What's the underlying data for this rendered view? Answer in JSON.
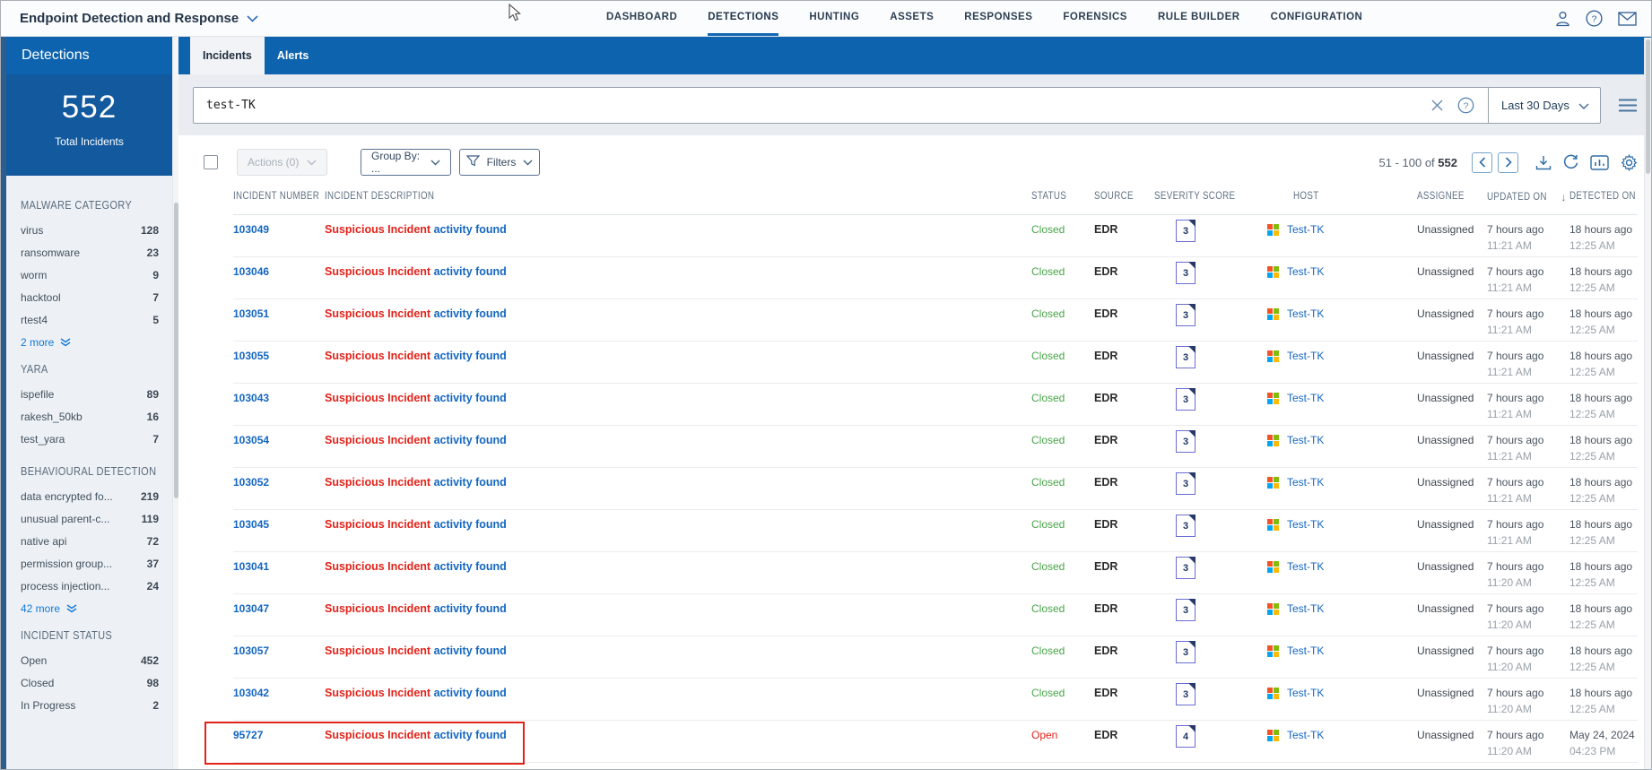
{
  "app": {
    "title": "Endpoint Detection and Response"
  },
  "nav": {
    "items": [
      {
        "label": "DASHBOARD",
        "active": false
      },
      {
        "label": "DETECTIONS",
        "active": true
      },
      {
        "label": "HUNTING",
        "active": false
      },
      {
        "label": "ASSETS",
        "active": false
      },
      {
        "label": "RESPONSES",
        "active": false
      },
      {
        "label": "FORENSICS",
        "active": false
      },
      {
        "label": "RULE BUILDER",
        "active": false
      },
      {
        "label": "CONFIGURATION",
        "active": false
      }
    ]
  },
  "top_icons": [
    "user-icon",
    "help-icon",
    "mail-icon"
  ],
  "sidebar": {
    "title": "Detections",
    "total": {
      "value": "552",
      "label": "Total Incidents"
    },
    "facets": [
      {
        "title": "MALWARE CATEGORY",
        "items": [
          {
            "label": "virus",
            "count": "128"
          },
          {
            "label": "ransomware",
            "count": "23"
          },
          {
            "label": "worm",
            "count": "9"
          },
          {
            "label": "hacktool",
            "count": "7"
          },
          {
            "label": "rtest4",
            "count": "5"
          }
        ],
        "more": "2 more"
      },
      {
        "title": "YARA",
        "items": [
          {
            "label": "ispefile",
            "count": "89"
          },
          {
            "label": "rakesh_50kb",
            "count": "16"
          },
          {
            "label": "test_yara",
            "count": "7"
          }
        ],
        "more": null
      },
      {
        "title": "BEHAVIOURAL DETECTION",
        "items": [
          {
            "label": "data encrypted fo...",
            "count": "219"
          },
          {
            "label": "unusual parent-c...",
            "count": "119"
          },
          {
            "label": "native api",
            "count": "72"
          },
          {
            "label": "permission group...",
            "count": "37"
          },
          {
            "label": "process injection...",
            "count": "24"
          }
        ],
        "more": "42 more"
      },
      {
        "title": "INCIDENT STATUS",
        "items": [
          {
            "label": "Open",
            "count": "452"
          },
          {
            "label": "Closed",
            "count": "98"
          },
          {
            "label": "In Progress",
            "count": "2"
          }
        ],
        "more": null
      }
    ]
  },
  "tabs": [
    {
      "label": "Incidents",
      "active": true
    },
    {
      "label": "Alerts",
      "active": false
    }
  ],
  "search": {
    "value": "test-TK",
    "date_range": "Last 30 Days"
  },
  "toolbar": {
    "actions_label": "Actions (0)",
    "group_by_label": "Group By: ...",
    "filters_label": "Filters",
    "pagination": {
      "range": "51 - 100 of",
      "total": "552"
    }
  },
  "table": {
    "columns": [
      "INCIDENT NUMBER",
      "INCIDENT DESCRIPTION",
      "STATUS",
      "SOURCE",
      "SEVERITY SCORE",
      "HOST",
      "ASSIGNEE",
      "UPDATED ON",
      "DETECTED ON"
    ],
    "sorted_column": "UPDATED ON",
    "rows": [
      {
        "number": "103049",
        "desc_red": "Suspicious Incident",
        "desc_blue": "activity found",
        "status": "Closed",
        "source": "EDR",
        "severity": "3",
        "host": "Test-TK",
        "assignee": "Unassigned",
        "updated": [
          "7 hours ago",
          "11:21 AM"
        ],
        "detected": [
          "18 hours ago",
          "12:25 AM"
        ],
        "highlighted": false
      },
      {
        "number": "103046",
        "desc_red": "Suspicious Incident",
        "desc_blue": "activity found",
        "status": "Closed",
        "source": "EDR",
        "severity": "3",
        "host": "Test-TK",
        "assignee": "Unassigned",
        "updated": [
          "7 hours ago",
          "11:21 AM"
        ],
        "detected": [
          "18 hours ago",
          "12:25 AM"
        ],
        "highlighted": false
      },
      {
        "number": "103051",
        "desc_red": "Suspicious Incident",
        "desc_blue": "activity found",
        "status": "Closed",
        "source": "EDR",
        "severity": "3",
        "host": "Test-TK",
        "assignee": "Unassigned",
        "updated": [
          "7 hours ago",
          "11:21 AM"
        ],
        "detected": [
          "18 hours ago",
          "12:25 AM"
        ],
        "highlighted": false
      },
      {
        "number": "103055",
        "desc_red": "Suspicious Incident",
        "desc_blue": "activity found",
        "status": "Closed",
        "source": "EDR",
        "severity": "3",
        "host": "Test-TK",
        "assignee": "Unassigned",
        "updated": [
          "7 hours ago",
          "11:21 AM"
        ],
        "detected": [
          "18 hours ago",
          "12:25 AM"
        ],
        "highlighted": false
      },
      {
        "number": "103043",
        "desc_red": "Suspicious Incident",
        "desc_blue": "activity found",
        "status": "Closed",
        "source": "EDR",
        "severity": "3",
        "host": "Test-TK",
        "assignee": "Unassigned",
        "updated": [
          "7 hours ago",
          "11:21 AM"
        ],
        "detected": [
          "18 hours ago",
          "12:25 AM"
        ],
        "highlighted": false
      },
      {
        "number": "103054",
        "desc_red": "Suspicious Incident",
        "desc_blue": "activity found",
        "status": "Closed",
        "source": "EDR",
        "severity": "3",
        "host": "Test-TK",
        "assignee": "Unassigned",
        "updated": [
          "7 hours ago",
          "11:21 AM"
        ],
        "detected": [
          "18 hours ago",
          "12:25 AM"
        ],
        "highlighted": false
      },
      {
        "number": "103052",
        "desc_red": "Suspicious Incident",
        "desc_blue": "activity found",
        "status": "Closed",
        "source": "EDR",
        "severity": "3",
        "host": "Test-TK",
        "assignee": "Unassigned",
        "updated": [
          "7 hours ago",
          "11:21 AM"
        ],
        "detected": [
          "18 hours ago",
          "12:25 AM"
        ],
        "highlighted": false
      },
      {
        "number": "103045",
        "desc_red": "Suspicious Incident",
        "desc_blue": "activity found",
        "status": "Closed",
        "source": "EDR",
        "severity": "3",
        "host": "Test-TK",
        "assignee": "Unassigned",
        "updated": [
          "7 hours ago",
          "11:21 AM"
        ],
        "detected": [
          "18 hours ago",
          "12:25 AM"
        ],
        "highlighted": false
      },
      {
        "number": "103041",
        "desc_red": "Suspicious Incident",
        "desc_blue": "activity found",
        "status": "Closed",
        "source": "EDR",
        "severity": "3",
        "host": "Test-TK",
        "assignee": "Unassigned",
        "updated": [
          "7 hours ago",
          "11:20 AM"
        ],
        "detected": [
          "18 hours ago",
          "12:25 AM"
        ],
        "highlighted": false
      },
      {
        "number": "103047",
        "desc_red": "Suspicious Incident",
        "desc_blue": "activity found",
        "status": "Closed",
        "source": "EDR",
        "severity": "3",
        "host": "Test-TK",
        "assignee": "Unassigned",
        "updated": [
          "7 hours ago",
          "11:20 AM"
        ],
        "detected": [
          "18 hours ago",
          "12:25 AM"
        ],
        "highlighted": false
      },
      {
        "number": "103057",
        "desc_red": "Suspicious Incident",
        "desc_blue": "activity found",
        "status": "Closed",
        "source": "EDR",
        "severity": "3",
        "host": "Test-TK",
        "assignee": "Unassigned",
        "updated": [
          "7 hours ago",
          "11:20 AM"
        ],
        "detected": [
          "18 hours ago",
          "12:25 AM"
        ],
        "highlighted": false
      },
      {
        "number": "103042",
        "desc_red": "Suspicious Incident",
        "desc_blue": "activity found",
        "status": "Closed",
        "source": "EDR",
        "severity": "3",
        "host": "Test-TK",
        "assignee": "Unassigned",
        "updated": [
          "7 hours ago",
          "11:20 AM"
        ],
        "detected": [
          "18 hours ago",
          "12:25 AM"
        ],
        "highlighted": false
      },
      {
        "number": "95727",
        "desc_red": "Suspicious Incident",
        "desc_blue": "activity found",
        "status": "Open",
        "source": "EDR",
        "severity": "4",
        "host": "Test-TK",
        "assignee": "Unassigned",
        "updated": [
          "7 hours ago",
          "11:20 AM"
        ],
        "detected": [
          "May 24, 2024",
          "04:23 PM"
        ],
        "highlighted": true
      }
    ]
  }
}
